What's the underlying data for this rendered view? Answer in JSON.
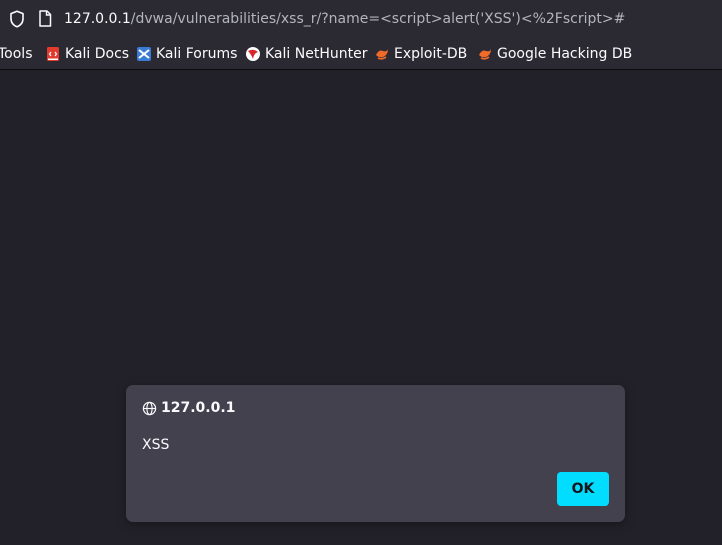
{
  "address_bar": {
    "host": "127.0.0.1",
    "path": "/dvwa/vulnerabilities/xss_r/?name=<script>alert('XSS')<%2Fscript>#",
    "shield_icon": "shield-icon",
    "page_icon": "page-icon"
  },
  "bookmarks": [
    {
      "label": "Tools",
      "icon": "none"
    },
    {
      "label": "Kali Docs",
      "icon": "kali-docs-icon"
    },
    {
      "label": "Kali Forums",
      "icon": "kali-forums-icon"
    },
    {
      "label": "Kali NetHunter",
      "icon": "nethunter-icon"
    },
    {
      "label": "Exploit-DB",
      "icon": "exploit-db-icon"
    },
    {
      "label": "Google Hacking DB",
      "icon": "ghdb-icon"
    }
  ],
  "dialog": {
    "origin": "127.0.0.1",
    "message": "XSS",
    "ok_label": "OK",
    "origin_icon": "globe-icon"
  },
  "colors": {
    "toolbar": "#2b2a33",
    "content": "#222129",
    "dialog": "#42414d",
    "accent": "#00ddff"
  }
}
